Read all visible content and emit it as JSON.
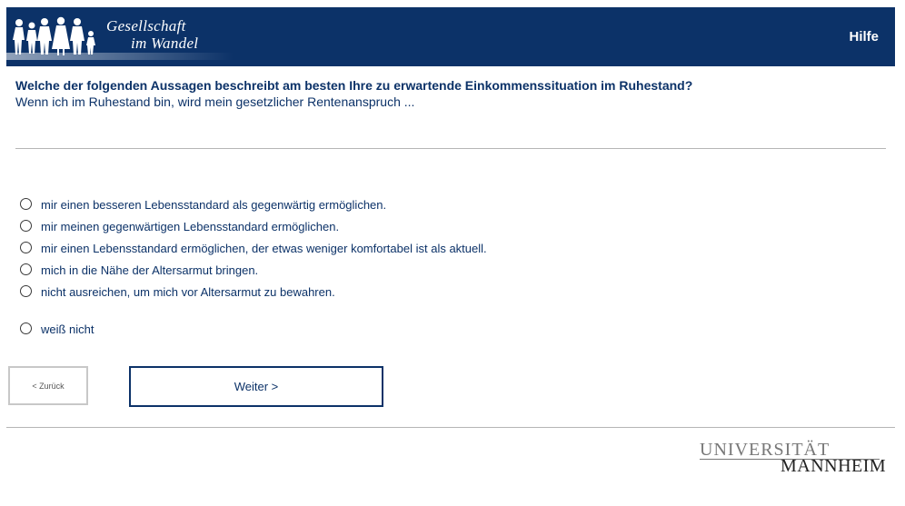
{
  "header": {
    "logo_line1": "Gesellschaft",
    "logo_line2": "im Wandel",
    "help_label": "Hilfe"
  },
  "question": {
    "title": "Welche der folgenden Aussagen beschreibt am besten Ihre zu erwartende Einkommenssituation im Ruhestand?",
    "subtitle": "Wenn ich im Ruhestand bin, wird mein gesetzlicher Rentenanspruch ..."
  },
  "options": [
    {
      "label": "mir einen besseren Lebensstandard als gegenwärtig ermöglichen.",
      "selected": false
    },
    {
      "label": "mir meinen gegenwärtigen Lebensstandard ermöglichen.",
      "selected": false
    },
    {
      "label": "mir einen Lebensstandard ermöglichen, der etwas weniger komfortabel ist als aktuell.",
      "selected": false
    },
    {
      "label": "mich in die Nähe der Altersarmut bringen.",
      "selected": false
    },
    {
      "label": "nicht ausreichen, um mich vor Altersarmut zu bewahren.",
      "selected": false
    },
    {
      "label": "weiß nicht",
      "selected": false
    }
  ],
  "navigation": {
    "back_label": "< Zurück",
    "next_label": "Weiter >"
  },
  "footer": {
    "university_line1": "UNIVERSITÄT",
    "university_line2": "MANNHEIM"
  },
  "colors": {
    "brand": "#0c3268",
    "rule": "#b5b5b5"
  }
}
